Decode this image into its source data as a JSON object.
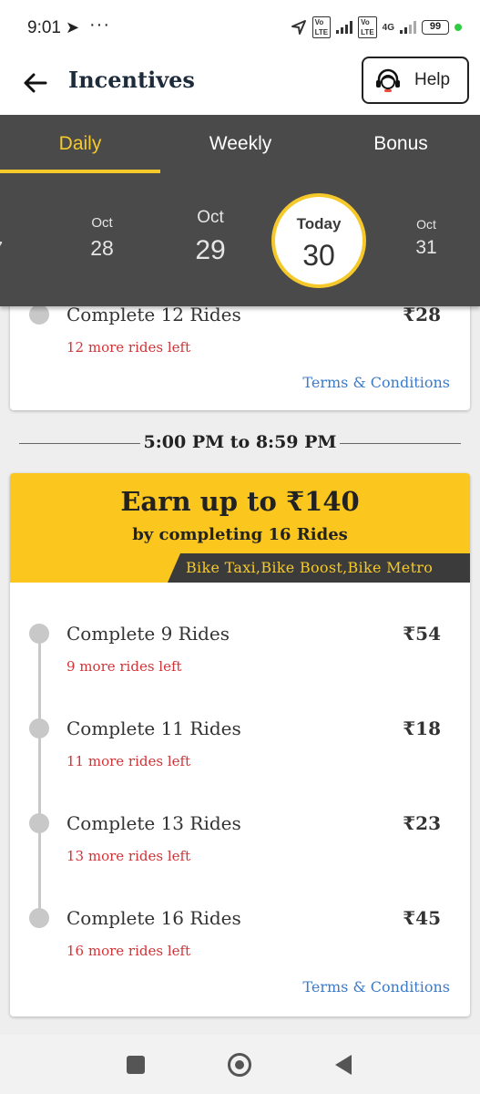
{
  "status_bar": {
    "time": "9:01",
    "dots": "···",
    "network": "4G",
    "battery": "99"
  },
  "header": {
    "title": "Incentives",
    "help_label": "Help"
  },
  "tabs": [
    {
      "label": "Daily",
      "active": true
    },
    {
      "label": "Weekly",
      "active": false
    },
    {
      "label": "Bonus",
      "active": false
    }
  ],
  "dates": {
    "partial": {
      "month": "t",
      "day": "7"
    },
    "d28": {
      "month": "Oct",
      "day": "28"
    },
    "d29": {
      "month": "Oct",
      "day": "29"
    },
    "today": {
      "month": "Today",
      "day": "30"
    },
    "d31": {
      "month": "Oct",
      "day": "31"
    }
  },
  "card1": {
    "milestone": {
      "title": "Complete 12 Rides",
      "left": "12 more rides left",
      "amount": "₹28"
    },
    "terms": "Terms & Conditions"
  },
  "slot": {
    "time_range": "5:00 PM to 8:59 PM"
  },
  "card2": {
    "headline": "Earn up to ₹140",
    "subline": "by completing 16 Rides",
    "services": "Bike Taxi,Bike Boost,Bike Metro",
    "milestones": [
      {
        "title": "Complete 9 Rides",
        "left": "9 more rides left",
        "amount": "₹54"
      },
      {
        "title": "Complete 11 Rides",
        "left": "11 more rides left",
        "amount": "₹18"
      },
      {
        "title": "Complete 13 Rides",
        "left": "13 more rides left",
        "amount": "₹23"
      },
      {
        "title": "Complete 16 Rides",
        "left": "16 more rides left",
        "amount": "₹45"
      }
    ],
    "terms": "Terms & Conditions"
  },
  "colors": {
    "accent": "#fbc61d",
    "tab_active": "#f5c92a",
    "panel": "#4a4a4a",
    "rides_left": "#d13438",
    "link": "#3b7bc8"
  }
}
